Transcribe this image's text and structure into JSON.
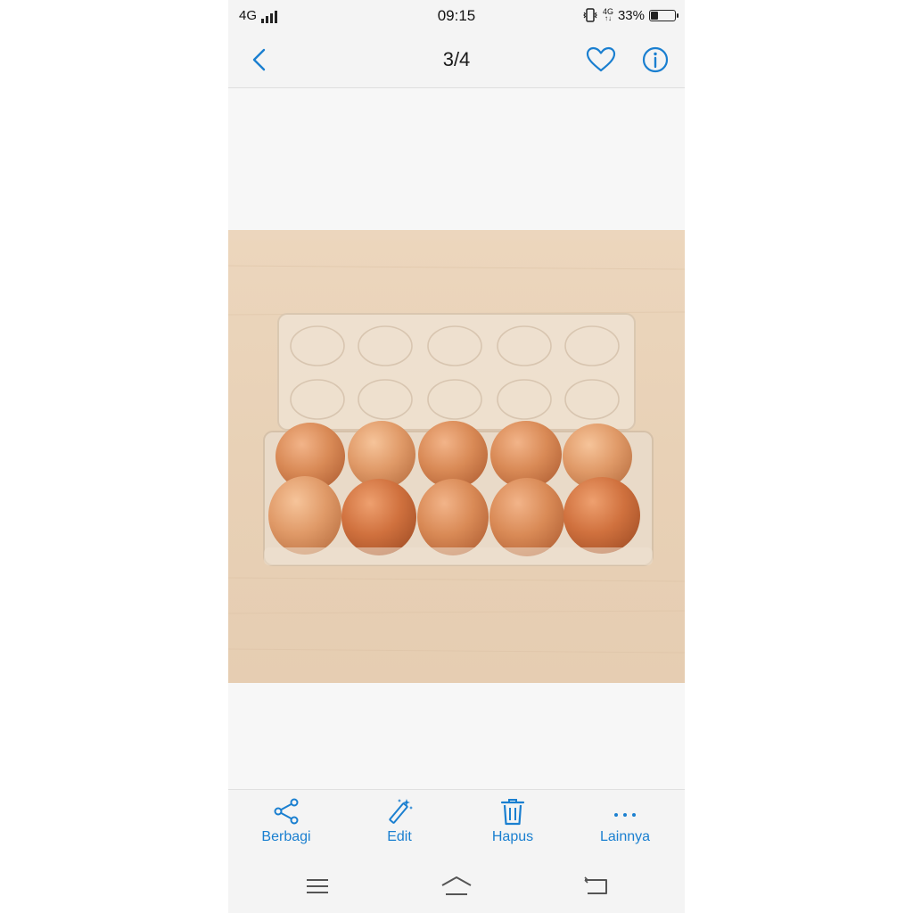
{
  "status_bar": {
    "network": "4G",
    "time": "09:15",
    "mobile_data": "4G",
    "battery_percent": "33%",
    "battery_level": 0.33,
    "icons": [
      "signal-icon",
      "vibrate-icon",
      "mobile-data-icon",
      "battery-icon"
    ]
  },
  "header": {
    "title": "3/4",
    "icons": [
      "back-icon",
      "heart-icon",
      "info-icon"
    ],
    "accent_color": "#1a7fd0"
  },
  "photo": {
    "subject": "ten brown eggs in a clear plastic egg tray on a wooden surface",
    "icon": "photo"
  },
  "actions": [
    {
      "label": "Berbagi",
      "icon": "share-icon"
    },
    {
      "label": "Edit",
      "icon": "magic-wand-icon"
    },
    {
      "label": "Hapus",
      "icon": "trash-icon"
    },
    {
      "label": "Lainnya",
      "icon": "more-icon"
    }
  ],
  "nav_bar": {
    "icons": [
      "menu-icon",
      "home-icon",
      "back-nav-icon"
    ]
  }
}
